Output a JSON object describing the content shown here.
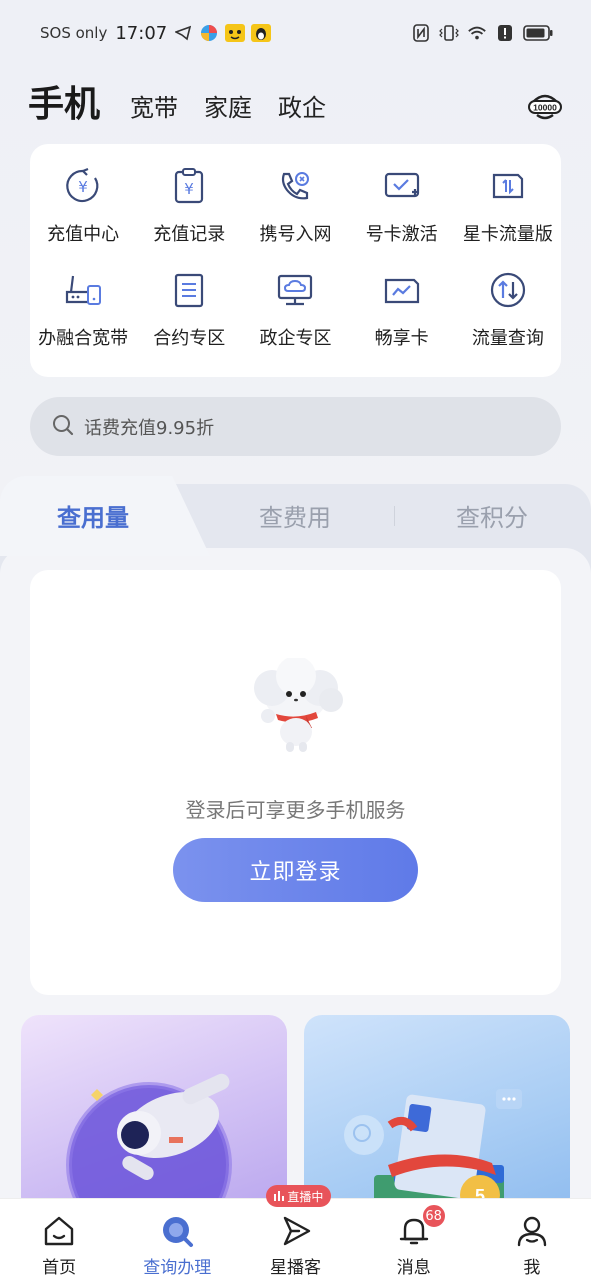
{
  "status_bar": {
    "carrier": "SOS only",
    "time": "17:07"
  },
  "top_nav": {
    "tabs": [
      "手机",
      "宽带",
      "家庭",
      "政企"
    ],
    "service_label": "10000"
  },
  "menu": {
    "items": [
      {
        "label": "充值中心",
        "icon": "recharge-center-icon"
      },
      {
        "label": "充值记录",
        "icon": "recharge-record-icon"
      },
      {
        "label": "携号入网",
        "icon": "number-portability-icon"
      },
      {
        "label": "号卡激活",
        "icon": "sim-activate-icon"
      },
      {
        "label": "星卡流量版",
        "icon": "star-card-icon"
      },
      {
        "label": "办融合宽带",
        "icon": "broadband-router-icon"
      },
      {
        "label": "合约专区",
        "icon": "contract-icon"
      },
      {
        "label": "政企专区",
        "icon": "enterprise-icon"
      },
      {
        "label": "畅享卡",
        "icon": "enjoy-card-icon"
      },
      {
        "label": "流量查询",
        "icon": "data-query-icon"
      }
    ]
  },
  "search": {
    "placeholder": "话费充值9.95折"
  },
  "usage": {
    "tabs": [
      "查用量",
      "查费用",
      "查积分"
    ],
    "active_tab": 0,
    "login_hint": "登录后可享更多手机服务",
    "login_button": "立即登录"
  },
  "bottom_nav": {
    "items": [
      {
        "label": "首页"
      },
      {
        "label": "查询办理"
      },
      {
        "label": "星播客",
        "badge": "直播中"
      },
      {
        "label": "消息",
        "badge": "68"
      },
      {
        "label": "我"
      }
    ],
    "active_index": 1
  },
  "colors": {
    "accent": "#4a6fd0",
    "login_button": "#6b84eb",
    "badge": "#e8545a"
  }
}
